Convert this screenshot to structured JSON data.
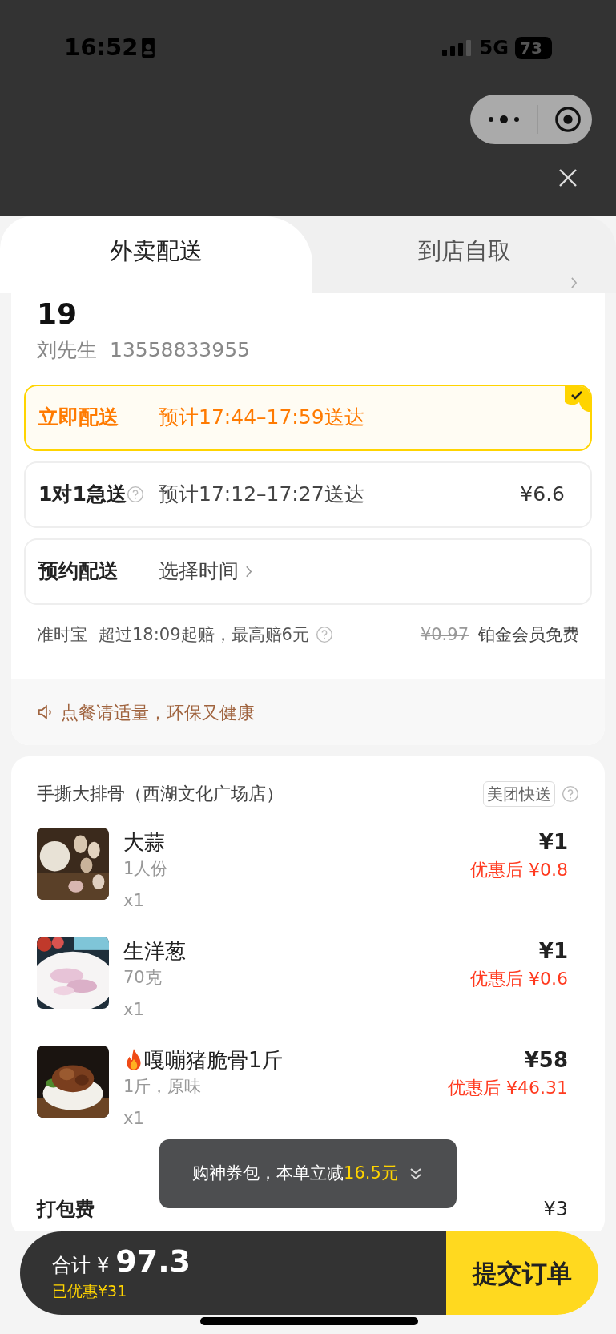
{
  "status_bar": {
    "time": "16:52",
    "network": "5G",
    "battery": "73"
  },
  "tabs": [
    {
      "label": "外卖配送",
      "selected": true
    },
    {
      "label": "到店自取",
      "selected": false
    }
  ],
  "address": {
    "title": "19",
    "contact": "刘先生",
    "phone": "13558833955"
  },
  "delivery_options": [
    {
      "title": "立即配送",
      "eta": "预计17:44–17:59送达",
      "selected": true,
      "help_icon": false,
      "chevron": false
    },
    {
      "title": "1对1急送",
      "eta": "预计17:12–17:27送达",
      "price": "¥6.6",
      "selected": false,
      "help_icon": true,
      "chevron": false
    },
    {
      "title": "预约配送",
      "eta": "选择时间",
      "selected": false,
      "help_icon": false,
      "chevron": true
    }
  ],
  "guarantee": {
    "name": "准时宝",
    "terms": "超过18:09起赔，最高赔6元",
    "old_price": "¥0.97",
    "member_note": "铂金会员免费"
  },
  "tip": "点餐请适量，环保又健康",
  "store": {
    "name": "手撕大排骨（西湖文化广场店）",
    "badge": "美团快送",
    "items": [
      {
        "name": "大蒜",
        "spec": "1人份",
        "qty": "x1",
        "price": "¥1",
        "discount_label": "优惠后",
        "discount_price": "¥0.8",
        "hot": false
      },
      {
        "name": "生洋葱",
        "spec": "70克",
        "qty": "x1",
        "price": "¥1",
        "discount_label": "优惠后",
        "discount_price": "¥0.6",
        "hot": false
      },
      {
        "name": "嘎嘣猪脆骨1斤",
        "spec": "1斤，原味",
        "qty": "x1",
        "price": "¥58",
        "discount_label": "优惠后",
        "discount_price": "¥46.31",
        "hot": true
      }
    ],
    "packing_fee": {
      "label": "打包费",
      "price": "¥3"
    }
  },
  "toast": {
    "text": "购神券包，本单立减",
    "highlight": "16.5元"
  },
  "footer": {
    "total_label": "合计",
    "currency": "¥",
    "total": "97.3",
    "saved": "已优惠¥31",
    "submit": "提交订单"
  }
}
